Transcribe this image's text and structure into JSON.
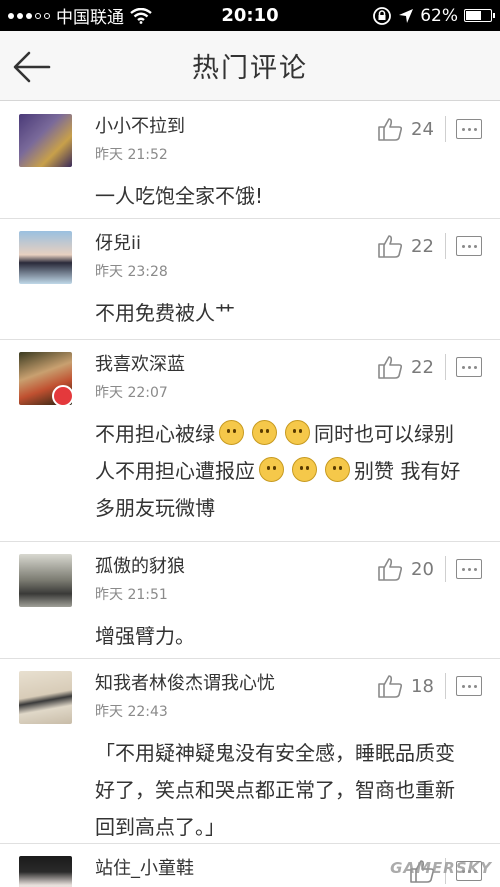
{
  "status_bar": {
    "carrier": "中国联通",
    "time": "20:10",
    "battery": "62%",
    "battery_level": 0.62
  },
  "nav": {
    "title": "热门评论"
  },
  "comments": [
    {
      "username": "小小不拉到",
      "time": "昨天 21:52",
      "likes": "24",
      "text": "一人吃饱全家不饿!"
    },
    {
      "username": "伢兒ii",
      "time": "昨天 23:28",
      "likes": "22",
      "text": "不用免费被人艹"
    },
    {
      "username": "我喜欢深蓝",
      "time": "昨天 22:07",
      "likes": "22",
      "text_parts": [
        "不用担心被绿",
        "同时也可以绿别人不用担心遭报应",
        "别赞 我有好多朋友玩微博"
      ]
    },
    {
      "username": "孤傲的豺狼",
      "time": "昨天 21:51",
      "likes": "20",
      "text": "增强臂力。"
    },
    {
      "username": "知我者林俊杰谓我心忧",
      "time": "昨天 22:43",
      "likes": "18",
      "text": "「不用疑神疑鬼没有安全感，睡眠品质变好了，笑点和哭点都正常了，智商也重新回到高点了。」"
    },
    {
      "username": "站住_小童鞋"
    }
  ],
  "watermark": "GAMERSKY",
  "icons": [
    "wifi-icon",
    "lock-rotation-icon",
    "location-arrow-icon",
    "battery-icon",
    "back-arrow-icon",
    "thumbs-up-icon",
    "more-icon",
    "emoji-icon"
  ]
}
